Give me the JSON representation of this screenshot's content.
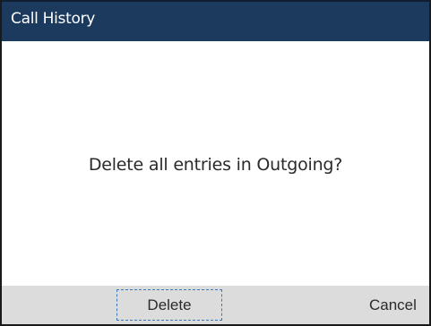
{
  "header": {
    "title": "Call History"
  },
  "dialog": {
    "message": "Delete all entries in Outgoing?"
  },
  "softkeys": {
    "delete_label": "Delete",
    "cancel_label": "Cancel"
  },
  "colors": {
    "title_bar": "#1c3a5e",
    "softkey_bar": "#dcdcdc",
    "focus_outline": "#3a78b8"
  }
}
